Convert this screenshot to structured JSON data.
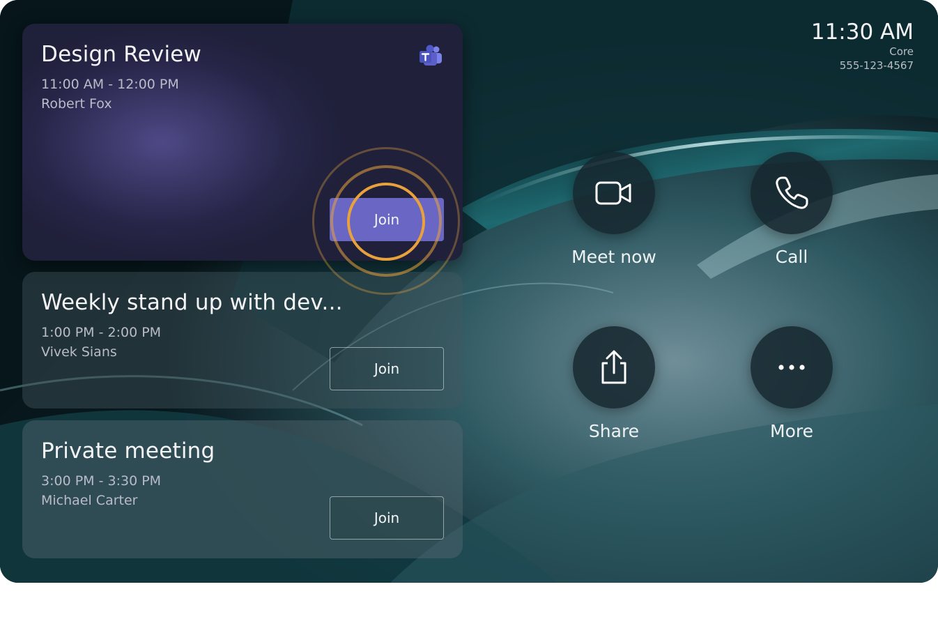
{
  "status": {
    "time": "11:30 AM",
    "device_name": "Core",
    "phone_number": "555-123-4567"
  },
  "meetings": [
    {
      "title": "Design Review",
      "time": "11:00 AM - 12:00 PM",
      "organizer": "Robert Fox",
      "join_label": "Join",
      "highlighted": true,
      "icon": "teams-icon"
    },
    {
      "title": "Weekly stand up with dev...",
      "time": "1:00 PM - 2:00 PM",
      "organizer": "Vivek Sians",
      "join_label": "Join"
    },
    {
      "title": "Private meeting",
      "time": "3:00 PM - 3:30 PM",
      "organizer": "Michael Carter",
      "join_label": "Join"
    }
  ],
  "actions": [
    {
      "label": "Meet now",
      "icon": "video-camera-icon"
    },
    {
      "label": "Call",
      "icon": "phone-icon"
    },
    {
      "label": "Share",
      "icon": "share-icon"
    },
    {
      "label": "More",
      "icon": "more-icon"
    }
  ],
  "colors": {
    "join_primary": "#6a67c4",
    "highlight_ring": "#e9a23b",
    "card_active": "#2a2850"
  }
}
